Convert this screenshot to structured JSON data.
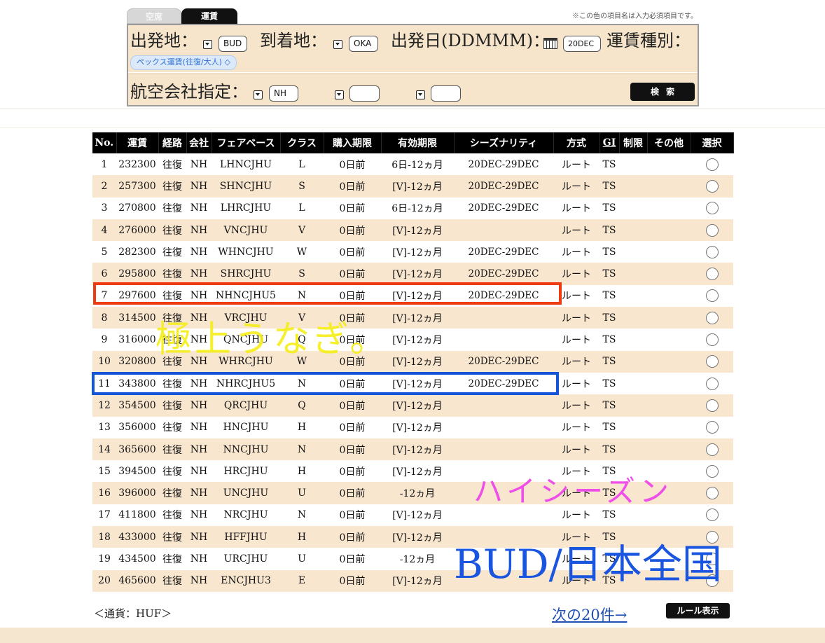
{
  "tabs": {
    "vacancy": "空席",
    "fare": "運賃"
  },
  "required_note": "※この色の項目名は入力必須項目です。",
  "search": {
    "origin_label": "出発地：",
    "origin_value": "BUD",
    "destination_label": "到着地：",
    "destination_value": "OKA",
    "date_label": "出発日(DDMMM)：",
    "date_value": "20DEC",
    "fare_type_label": "運賃種別：",
    "fare_type_value": "ペックス運賃(往復/大人) ◇",
    "airline_label": "航空会社指定：",
    "airline_values": [
      "NH",
      "",
      ""
    ],
    "search_button": "検索"
  },
  "table": {
    "headers": [
      "No.",
      "運賃",
      "経路",
      "会社",
      "フェアベース",
      "クラス",
      "購入期限",
      "有効期限",
      "シーズナリティ",
      "方式",
      "GI",
      "制限",
      "その他",
      "選択"
    ],
    "rows": [
      {
        "no": "1",
        "fare": "232300",
        "route": "往復",
        "carrier": "NH",
        "fare_basis": "LHNCJHU",
        "cls": "L",
        "purchase": "0日前",
        "validity": "6日-12ヵ月",
        "season": "20DEC-29DEC",
        "method": "ルート",
        "gi": "TS",
        "limit": "",
        "other": ""
      },
      {
        "no": "2",
        "fare": "257300",
        "route": "往復",
        "carrier": "NH",
        "fare_basis": "SHNCJHU",
        "cls": "S",
        "purchase": "0日前",
        "validity": "[V]-12ヵ月",
        "season": "20DEC-29DEC",
        "method": "ルート",
        "gi": "TS",
        "limit": "",
        "other": ""
      },
      {
        "no": "3",
        "fare": "270800",
        "route": "往復",
        "carrier": "NH",
        "fare_basis": "LHRCJHU",
        "cls": "L",
        "purchase": "0日前",
        "validity": "6日-12ヵ月",
        "season": "20DEC-29DEC",
        "method": "ルート",
        "gi": "TS",
        "limit": "",
        "other": ""
      },
      {
        "no": "4",
        "fare": "276000",
        "route": "往復",
        "carrier": "NH",
        "fare_basis": "VNCJHU",
        "cls": "V",
        "purchase": "0日前",
        "validity": "[V]-12ヵ月",
        "season": "",
        "method": "ルート",
        "gi": "TS",
        "limit": "",
        "other": ""
      },
      {
        "no": "5",
        "fare": "282300",
        "route": "往復",
        "carrier": "NH",
        "fare_basis": "WHNCJHU",
        "cls": "W",
        "purchase": "0日前",
        "validity": "[V]-12ヵ月",
        "season": "20DEC-29DEC",
        "method": "ルート",
        "gi": "TS",
        "limit": "",
        "other": ""
      },
      {
        "no": "6",
        "fare": "295800",
        "route": "往復",
        "carrier": "NH",
        "fare_basis": "SHRCJHU",
        "cls": "S",
        "purchase": "0日前",
        "validity": "[V]-12ヵ月",
        "season": "20DEC-29DEC",
        "method": "ルート",
        "gi": "TS",
        "limit": "",
        "other": ""
      },
      {
        "no": "7",
        "fare": "297600",
        "route": "往復",
        "carrier": "NH",
        "fare_basis": "NHNCJHU5",
        "cls": "N",
        "purchase": "0日前",
        "validity": "[V]-12ヵ月",
        "season": "20DEC-29DEC",
        "method": "ルート",
        "gi": "TS",
        "limit": "",
        "other": ""
      },
      {
        "no": "8",
        "fare": "314500",
        "route": "往復",
        "carrier": "NH",
        "fare_basis": "VRCJHU",
        "cls": "V",
        "purchase": "0日前",
        "validity": "[V]-12ヵ月",
        "season": "",
        "method": "ルート",
        "gi": "TS",
        "limit": "",
        "other": ""
      },
      {
        "no": "9",
        "fare": "316000",
        "route": "往復",
        "carrier": "NH",
        "fare_basis": "QNCJHU",
        "cls": "Q",
        "purchase": "0日前",
        "validity": "[V]-12ヵ月",
        "season": "",
        "method": "ルート",
        "gi": "TS",
        "limit": "",
        "other": ""
      },
      {
        "no": "10",
        "fare": "320800",
        "route": "往復",
        "carrier": "NH",
        "fare_basis": "WHRCJHU",
        "cls": "W",
        "purchase": "0日前",
        "validity": "[V]-12ヵ月",
        "season": "20DEC-29DEC",
        "method": "ルート",
        "gi": "TS",
        "limit": "",
        "other": ""
      },
      {
        "no": "11",
        "fare": "343800",
        "route": "往復",
        "carrier": "NH",
        "fare_basis": "NHRCJHU5",
        "cls": "N",
        "purchase": "0日前",
        "validity": "[V]-12ヵ月",
        "season": "20DEC-29DEC",
        "method": "ルート",
        "gi": "TS",
        "limit": "",
        "other": ""
      },
      {
        "no": "12",
        "fare": "354500",
        "route": "往復",
        "carrier": "NH",
        "fare_basis": "QRCJHU",
        "cls": "Q",
        "purchase": "0日前",
        "validity": "[V]-12ヵ月",
        "season": "",
        "method": "ルート",
        "gi": "TS",
        "limit": "",
        "other": ""
      },
      {
        "no": "13",
        "fare": "356000",
        "route": "往復",
        "carrier": "NH",
        "fare_basis": "HNCJHU",
        "cls": "H",
        "purchase": "0日前",
        "validity": "[V]-12ヵ月",
        "season": "",
        "method": "ルート",
        "gi": "TS",
        "limit": "",
        "other": ""
      },
      {
        "no": "14",
        "fare": "365600",
        "route": "往復",
        "carrier": "NH",
        "fare_basis": "NNCJHU",
        "cls": "N",
        "purchase": "0日前",
        "validity": "[V]-12ヵ月",
        "season": "",
        "method": "ルート",
        "gi": "TS",
        "limit": "",
        "other": ""
      },
      {
        "no": "15",
        "fare": "394500",
        "route": "往復",
        "carrier": "NH",
        "fare_basis": "HRCJHU",
        "cls": "H",
        "purchase": "0日前",
        "validity": "[V]-12ヵ月",
        "season": "",
        "method": "ルート",
        "gi": "TS",
        "limit": "",
        "other": ""
      },
      {
        "no": "16",
        "fare": "396000",
        "route": "往復",
        "carrier": "NH",
        "fare_basis": "UNCJHU",
        "cls": "U",
        "purchase": "0日前",
        "validity": "-12ヵ月",
        "season": "",
        "method": "ルート",
        "gi": "TS",
        "limit": "",
        "other": ""
      },
      {
        "no": "17",
        "fare": "411800",
        "route": "往復",
        "carrier": "NH",
        "fare_basis": "NRCJHU",
        "cls": "N",
        "purchase": "0日前",
        "validity": "[V]-12ヵ月",
        "season": "",
        "method": "ルート",
        "gi": "TS",
        "limit": "",
        "other": ""
      },
      {
        "no": "18",
        "fare": "433000",
        "route": "往復",
        "carrier": "NH",
        "fare_basis": "HFFJHU",
        "cls": "H",
        "purchase": "0日前",
        "validity": "[V]-12ヵ月",
        "season": "",
        "method": "ルート",
        "gi": "TS",
        "limit": "",
        "other": ""
      },
      {
        "no": "19",
        "fare": "434500",
        "route": "往復",
        "carrier": "NH",
        "fare_basis": "URCJHU",
        "cls": "U",
        "purchase": "0日前",
        "validity": "-12ヵ月",
        "season": "",
        "method": "ルート",
        "gi": "TS",
        "limit": "",
        "other": ""
      },
      {
        "no": "20",
        "fare": "465600",
        "route": "往復",
        "carrier": "NH",
        "fare_basis": "ENCJHU3",
        "cls": "E",
        "purchase": "0日前",
        "validity": "[V]-12ヵ月",
        "season": "",
        "method": "ルート",
        "gi": "TS",
        "limit": "",
        "other": ""
      }
    ]
  },
  "footer": {
    "currency": "＜通貨：HUF＞",
    "next_link": "次の20件→",
    "rules_button": "ルール表示"
  },
  "annotations": {
    "yellow": "極上うなぎ。",
    "pink": "ハイシーズン",
    "blue": "BUD/日本全国",
    "colors": {
      "red_box": "#ee3b12",
      "blue_box": "#1654d8",
      "yellow_text": "#f6ee1d",
      "pink_text": "#ef4ee8",
      "blue_text": "#1a55e0"
    }
  }
}
